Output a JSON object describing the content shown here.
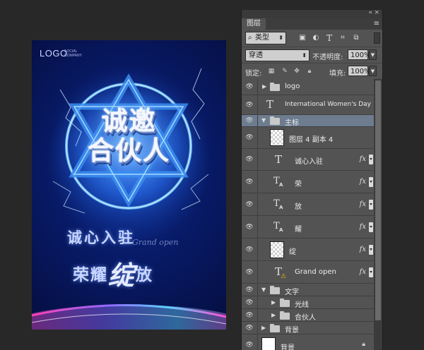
{
  "poster": {
    "logo": "LOGO",
    "logo_sub": "SOCIAL COMPANY",
    "hero_line1": "诚邀",
    "hero_line2": "合伙人",
    "slogan1": "诚心入驻",
    "grand_open_art": "Grand open",
    "slogan2_a": "荣耀",
    "slogan2_big": "绽",
    "slogan2_b": "放"
  },
  "panel": {
    "tab_label": "图层",
    "collapse_icon": "«",
    "close_icon": "×",
    "menu_icon": "≡",
    "filter": {
      "kind_label": "类型",
      "icons": [
        "image-filter-icon",
        "adjustment-filter-icon",
        "type-filter-icon",
        "shape-filter-icon",
        "smart-object-filter-icon"
      ]
    },
    "blend_mode": "穿透",
    "opacity_label": "不透明度:",
    "opacity_value": "100%",
    "lock_label": "锁定:",
    "fill_label": "填充:",
    "fill_value": "100%"
  },
  "layers": [
    {
      "name": "logo",
      "kind": "group",
      "collapsed": true,
      "indent": 0
    },
    {
      "name": "International Women's Day",
      "kind": "text",
      "indent": 0
    },
    {
      "name": "主标",
      "kind": "group",
      "collapsed": false,
      "indent": 0,
      "selected": true
    },
    {
      "name": "图层 4 副本 4",
      "kind": "pixel",
      "indent": 1
    },
    {
      "name": "诚心入驻",
      "kind": "text",
      "indent": 1,
      "fx": true
    },
    {
      "name": "荣",
      "kind": "text-warp",
      "indent": 1,
      "fx": true
    },
    {
      "name": "放",
      "kind": "text-warp",
      "indent": 1,
      "fx": true
    },
    {
      "name": "耀",
      "kind": "text-warp",
      "indent": 1,
      "fx": true
    },
    {
      "name": "绽",
      "kind": "pixel",
      "indent": 1,
      "fx": true
    },
    {
      "name": "Grand open",
      "kind": "text-warning",
      "indent": 1,
      "fx": true
    },
    {
      "name": "文字",
      "kind": "group",
      "collapsed": false,
      "indent": 0
    },
    {
      "name": "光线",
      "kind": "group",
      "collapsed": true,
      "indent": 1
    },
    {
      "name": "合伙人",
      "kind": "group",
      "collapsed": true,
      "indent": 1
    },
    {
      "name": "背景",
      "kind": "group",
      "collapsed": true,
      "indent": 0
    },
    {
      "name": "背景",
      "kind": "background",
      "indent": 0,
      "locked": true
    }
  ],
  "colors": {
    "panel_bg": "#535353",
    "selected_row": "#6d7c8f",
    "poster_blue": "#0b2a8f",
    "warning": "#f2c200"
  }
}
